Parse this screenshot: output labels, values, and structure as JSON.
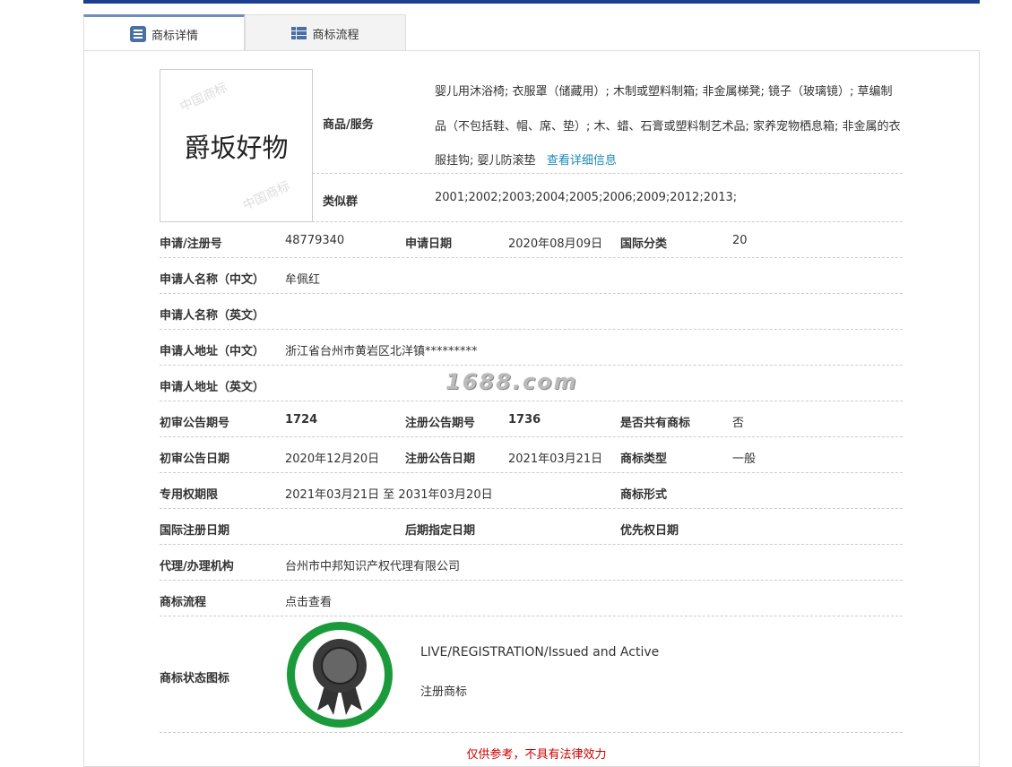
{
  "tabs": [
    {
      "label": "商标详情"
    },
    {
      "label": "商标流程"
    }
  ],
  "trademark_image_text": "爵坂好物",
  "goods": {
    "label": "商品/服务",
    "text": "婴儿用沐浴椅; 衣服罩（储藏用）; 木制或塑料制箱; 非金属梯凳; 镜子（玻璃镜）; 草编制品（不包括鞋、帽、席、垫）; 木、蜡、石膏或塑料制艺术品; 家养宠物栖息箱; 非金属的衣服挂钩; 婴儿防滚垫",
    "link": "查看详细信息"
  },
  "similar": {
    "label": "类似群",
    "value": "2001;2002;2003;2004;2005;2006;2009;2012;2013;"
  },
  "rows": [
    [
      {
        "l": "申请/注册号",
        "v": "48779340"
      },
      {
        "l": "申请日期",
        "v": "2020年08月09日"
      },
      {
        "l": "国际分类",
        "v": "20"
      }
    ],
    [
      {
        "l": "申请人名称（中文）",
        "v": "牟佩红"
      }
    ],
    [
      {
        "l": "申请人名称（英文）",
        "v": ""
      }
    ],
    [
      {
        "l": "申请人地址（中文）",
        "v": "浙江省台州市黄岩区北洋镇*********"
      }
    ],
    [
      {
        "l": "申请人地址（英文）",
        "v": ""
      }
    ],
    [
      {
        "l": "初审公告期号",
        "v": "1724"
      },
      {
        "l": "注册公告期号",
        "v": "1736"
      },
      {
        "l": "是否共有商标",
        "v": "否"
      }
    ],
    [
      {
        "l": "初审公告日期",
        "v": "2020年12月20日"
      },
      {
        "l": "注册公告日期",
        "v": "2021年03月21日"
      },
      {
        "l": "商标类型",
        "v": "一般"
      }
    ],
    [
      {
        "l": "专用权期限",
        "v": "2021年03月21日 至 2031年03月20日"
      },
      {
        "l": "",
        "v": ""
      },
      {
        "l": "商标形式",
        "v": ""
      }
    ],
    [
      {
        "l": "国际注册日期",
        "v": ""
      },
      {
        "l": "后期指定日期",
        "v": ""
      },
      {
        "l": "优先权日期",
        "v": ""
      }
    ],
    [
      {
        "l": "代理/办理机构",
        "v": "台州市中邦知识产权代理有限公司"
      }
    ],
    [
      {
        "l": "商标流程",
        "v": "点击查看"
      }
    ]
  ],
  "status": {
    "label": "商标状态图标",
    "en": "LIVE/REGISTRATION/Issued and Active",
    "cn": "注册商标"
  },
  "watermark": "1688.com",
  "footer": "仅供参考，不具有法律效力",
  "colors": {
    "badge": "#1b9a3c",
    "link": "#1a8ab5",
    "footer": "#cc0000"
  }
}
